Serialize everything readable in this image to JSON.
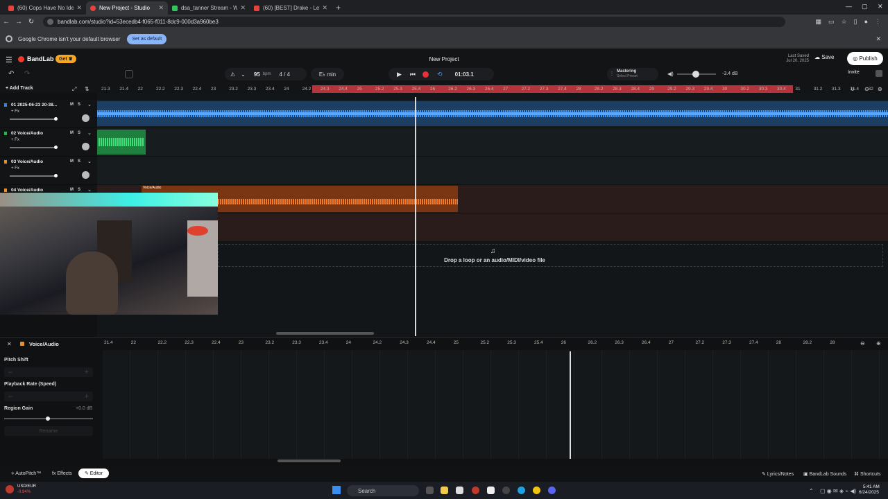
{
  "browser": {
    "tabs": [
      {
        "title": "(60) Cops Have No Idea They're",
        "color": "#e8423f"
      },
      {
        "title": "New Project - Studio",
        "color": "#e8423f"
      },
      {
        "title": "dsa_tanner Stream - Watch Live",
        "color": "#36c25c"
      },
      {
        "title": "(60) [BEST] Drake - Lemon Pepper",
        "color": "#e8423f"
      }
    ],
    "url": "bandlab.com/studio?id=53ecedb4-f065-f011-8dc9-000d3a960be3",
    "infobar_text": "Google Chrome isn't your default browser",
    "set_default_label": "Set as default"
  },
  "app": {
    "logo": "BandLab",
    "get_label": "Get",
    "project_title": "New Project",
    "last_saved_line1": "Last Saved",
    "last_saved_line2": "Jul 20, 2025",
    "save_label": "Save",
    "publish_label": "Publish",
    "invite_label": "Invite"
  },
  "transport": {
    "bpm": "95",
    "bpm_unit": "bpm",
    "time_sig": "4 / 4",
    "key": "E♭ min",
    "time": "01:03.1",
    "mastering_label": "Mastering",
    "mastering_sub": "Select Preset",
    "volume_db": "-3.4 dB"
  },
  "add_track_label": "Add Track",
  "ruler_ticks": [
    "21.3",
    "21.4",
    "22",
    "22.2",
    "22.3",
    "22.4",
    "23",
    "23.2",
    "23.3",
    "23.4",
    "24",
    "24.2",
    "24.3",
    "24.4",
    "25",
    "25.2",
    "25.3",
    "25.4",
    "26",
    "26.2",
    "26.3",
    "26.4",
    "27",
    "27.2",
    "27.3",
    "27.4",
    "28",
    "28.2",
    "28.3",
    "28.4",
    "29",
    "29.2",
    "29.3",
    "29.4",
    "30",
    "30.2",
    "30.3",
    "30.4",
    "31",
    "31.2",
    "31.3",
    "31.4",
    "32"
  ],
  "tracks": [
    {
      "name": "01  2025-06-23 20-38...",
      "color": "#3b82e0"
    },
    {
      "name": "02  Voice/Audio",
      "color": "#29b34a"
    },
    {
      "name": "03  Voice/Audio",
      "color": "#e8902a"
    },
    {
      "name": "04  Voice/Audio",
      "color": "#e8902a"
    }
  ],
  "track_ms": "MS",
  "track_fx": "+ Fx",
  "region_label": "Voice/Audio",
  "drop_text": "Drop a loop or an audio/MIDI/video file",
  "editor": {
    "title": "Voice/Audio",
    "pitch_shift": "Pitch Shift",
    "playback_rate": "Playback Rate (Speed)",
    "region_gain": "Region Gain",
    "region_gain_value": "+0.0 dB",
    "rename": "Rename",
    "ruler_ticks": [
      "21.4",
      "22",
      "22.2",
      "22.3",
      "22.4",
      "23",
      "23.2",
      "23.3",
      "23.4",
      "24",
      "24.2",
      "24.3",
      "24.4",
      "25",
      "25.2",
      "25.3",
      "25.4",
      "26",
      "26.2",
      "26.3",
      "26.4",
      "27",
      "27.2",
      "27.3",
      "27.4",
      "28",
      "28.2",
      "28"
    ]
  },
  "bottom": {
    "autopitch": "AutoPitch™",
    "effects": "Effects",
    "editor": "Editor",
    "lyrics": "Lyrics/Notes",
    "sounds": "BandLab Sounds",
    "shortcuts": "Shortcuts"
  },
  "taskbar": {
    "ticker": "USD/EUR",
    "ticker_change": "-0.94%",
    "search": "Search",
    "time": "5:41 AM",
    "date": "6/24/2025"
  }
}
